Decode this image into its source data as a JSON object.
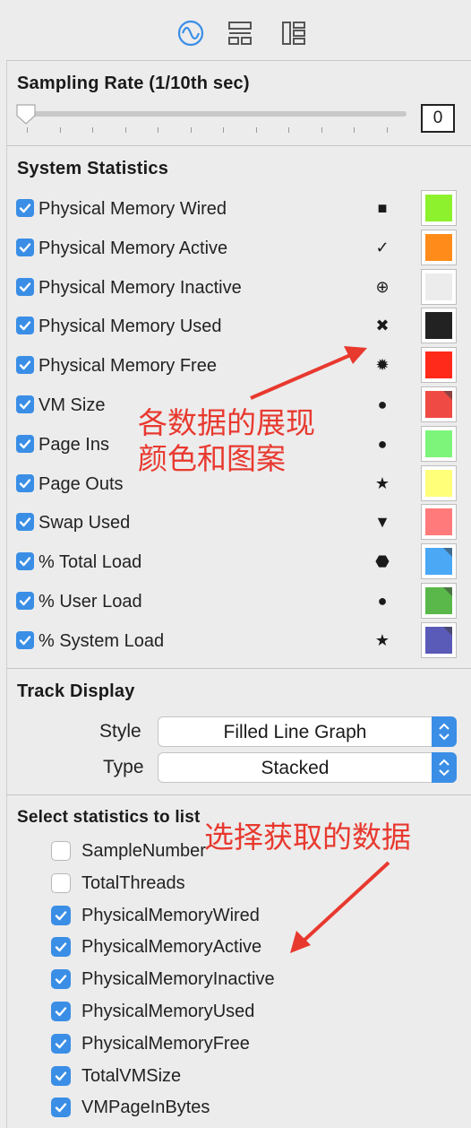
{
  "toolbar": {
    "icons": [
      "waveform-icon",
      "display-settings-icon",
      "list-settings-icon"
    ],
    "accent": "#3a8ee6"
  },
  "sampling": {
    "title": "Sampling Rate (1/10th sec)",
    "value": "0",
    "level": 0
  },
  "system_statistics": {
    "title": "System Statistics",
    "items": [
      {
        "label": "Physical Memory Wired",
        "checked": true,
        "symbol": "■",
        "color": "#8ef12e",
        "corner": false
      },
      {
        "label": "Physical Memory Active",
        "checked": true,
        "symbol": "✓",
        "color": "#ff8c1a",
        "corner": false
      },
      {
        "label": "Physical Memory Inactive",
        "checked": true,
        "symbol": "⊕",
        "color": "#ececec",
        "corner": false
      },
      {
        "label": "Physical Memory Used",
        "checked": true,
        "symbol": "✖",
        "color": "#222222",
        "corner": false
      },
      {
        "label": "Physical Memory Free",
        "checked": true,
        "symbol": "✹",
        "color": "#ff2a1a",
        "corner": false
      },
      {
        "label": "VM Size",
        "checked": true,
        "symbol": "●",
        "color": "#f04a44",
        "corner": true
      },
      {
        "label": "Page Ins",
        "checked": true,
        "symbol": "●",
        "color": "#7cf57a",
        "corner": false
      },
      {
        "label": "Page Outs",
        "checked": true,
        "symbol": "★",
        "color": "#ffff7a",
        "corner": false
      },
      {
        "label": "Swap Used",
        "checked": true,
        "symbol": "▼",
        "color": "#ff7a7a",
        "corner": false
      },
      {
        "label": "% Total Load",
        "checked": true,
        "symbol": "⬣",
        "color": "#4aa8f5",
        "corner": true
      },
      {
        "label": "% User Load",
        "checked": true,
        "symbol": "●",
        "color": "#5ab84a",
        "corner": true
      },
      {
        "label": "% System Load",
        "checked": true,
        "symbol": "★",
        "color": "#5a5ab8",
        "corner": true
      }
    ]
  },
  "track_display": {
    "title": "Track Display",
    "style_label": "Style",
    "style_value": "Filled Line Graph",
    "type_label": "Type",
    "type_value": "Stacked"
  },
  "select_statistics": {
    "title": "Select statistics to list",
    "items": [
      {
        "label": "SampleNumber",
        "checked": false
      },
      {
        "label": "TotalThreads",
        "checked": false
      },
      {
        "label": "PhysicalMemoryWired",
        "checked": true
      },
      {
        "label": "PhysicalMemoryActive",
        "checked": true
      },
      {
        "label": "PhysicalMemoryInactive",
        "checked": true
      },
      {
        "label": "PhysicalMemoryUsed",
        "checked": true
      },
      {
        "label": "PhysicalMemoryFree",
        "checked": true
      },
      {
        "label": "TotalVMSize",
        "checked": true
      },
      {
        "label": "VMPageInBytes",
        "checked": true
      }
    ]
  },
  "annotations": {
    "colors_line1": "各数据的展现",
    "colors_line2": "颜色和图案",
    "select_note": "选择获取的数据",
    "color": "#e8392f"
  }
}
